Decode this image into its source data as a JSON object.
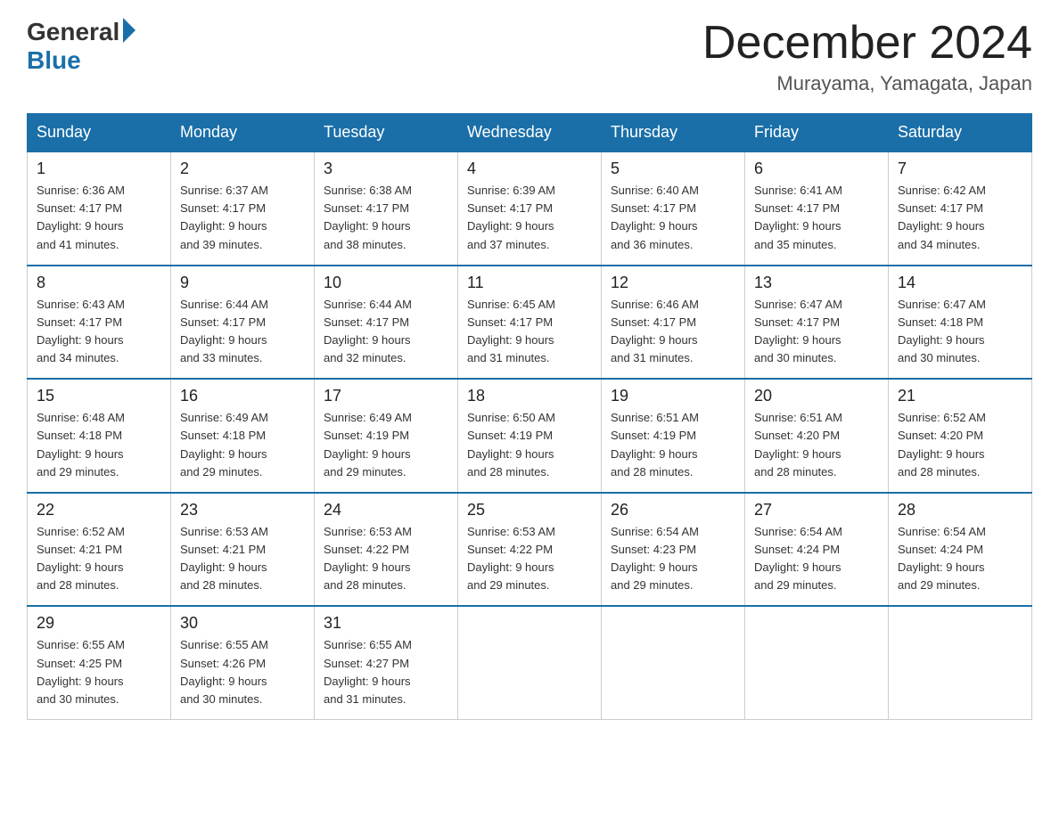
{
  "logo": {
    "text_general": "General",
    "text_blue": "Blue"
  },
  "header": {
    "title": "December 2024",
    "location": "Murayama, Yamagata, Japan"
  },
  "weekdays": [
    "Sunday",
    "Monday",
    "Tuesday",
    "Wednesday",
    "Thursday",
    "Friday",
    "Saturday"
  ],
  "weeks": [
    [
      {
        "day": "1",
        "sunrise": "6:36 AM",
        "sunset": "4:17 PM",
        "daylight": "9 hours and 41 minutes."
      },
      {
        "day": "2",
        "sunrise": "6:37 AM",
        "sunset": "4:17 PM",
        "daylight": "9 hours and 39 minutes."
      },
      {
        "day": "3",
        "sunrise": "6:38 AM",
        "sunset": "4:17 PM",
        "daylight": "9 hours and 38 minutes."
      },
      {
        "day": "4",
        "sunrise": "6:39 AM",
        "sunset": "4:17 PM",
        "daylight": "9 hours and 37 minutes."
      },
      {
        "day": "5",
        "sunrise": "6:40 AM",
        "sunset": "4:17 PM",
        "daylight": "9 hours and 36 minutes."
      },
      {
        "day": "6",
        "sunrise": "6:41 AM",
        "sunset": "4:17 PM",
        "daylight": "9 hours and 35 minutes."
      },
      {
        "day": "7",
        "sunrise": "6:42 AM",
        "sunset": "4:17 PM",
        "daylight": "9 hours and 34 minutes."
      }
    ],
    [
      {
        "day": "8",
        "sunrise": "6:43 AM",
        "sunset": "4:17 PM",
        "daylight": "9 hours and 34 minutes."
      },
      {
        "day": "9",
        "sunrise": "6:44 AM",
        "sunset": "4:17 PM",
        "daylight": "9 hours and 33 minutes."
      },
      {
        "day": "10",
        "sunrise": "6:44 AM",
        "sunset": "4:17 PM",
        "daylight": "9 hours and 32 minutes."
      },
      {
        "day": "11",
        "sunrise": "6:45 AM",
        "sunset": "4:17 PM",
        "daylight": "9 hours and 31 minutes."
      },
      {
        "day": "12",
        "sunrise": "6:46 AM",
        "sunset": "4:17 PM",
        "daylight": "9 hours and 31 minutes."
      },
      {
        "day": "13",
        "sunrise": "6:47 AM",
        "sunset": "4:17 PM",
        "daylight": "9 hours and 30 minutes."
      },
      {
        "day": "14",
        "sunrise": "6:47 AM",
        "sunset": "4:18 PM",
        "daylight": "9 hours and 30 minutes."
      }
    ],
    [
      {
        "day": "15",
        "sunrise": "6:48 AM",
        "sunset": "4:18 PM",
        "daylight": "9 hours and 29 minutes."
      },
      {
        "day": "16",
        "sunrise": "6:49 AM",
        "sunset": "4:18 PM",
        "daylight": "9 hours and 29 minutes."
      },
      {
        "day": "17",
        "sunrise": "6:49 AM",
        "sunset": "4:19 PM",
        "daylight": "9 hours and 29 minutes."
      },
      {
        "day": "18",
        "sunrise": "6:50 AM",
        "sunset": "4:19 PM",
        "daylight": "9 hours and 28 minutes."
      },
      {
        "day": "19",
        "sunrise": "6:51 AM",
        "sunset": "4:19 PM",
        "daylight": "9 hours and 28 minutes."
      },
      {
        "day": "20",
        "sunrise": "6:51 AM",
        "sunset": "4:20 PM",
        "daylight": "9 hours and 28 minutes."
      },
      {
        "day": "21",
        "sunrise": "6:52 AM",
        "sunset": "4:20 PM",
        "daylight": "9 hours and 28 minutes."
      }
    ],
    [
      {
        "day": "22",
        "sunrise": "6:52 AM",
        "sunset": "4:21 PM",
        "daylight": "9 hours and 28 minutes."
      },
      {
        "day": "23",
        "sunrise": "6:53 AM",
        "sunset": "4:21 PM",
        "daylight": "9 hours and 28 minutes."
      },
      {
        "day": "24",
        "sunrise": "6:53 AM",
        "sunset": "4:22 PM",
        "daylight": "9 hours and 28 minutes."
      },
      {
        "day": "25",
        "sunrise": "6:53 AM",
        "sunset": "4:22 PM",
        "daylight": "9 hours and 29 minutes."
      },
      {
        "day": "26",
        "sunrise": "6:54 AM",
        "sunset": "4:23 PM",
        "daylight": "9 hours and 29 minutes."
      },
      {
        "day": "27",
        "sunrise": "6:54 AM",
        "sunset": "4:24 PM",
        "daylight": "9 hours and 29 minutes."
      },
      {
        "day": "28",
        "sunrise": "6:54 AM",
        "sunset": "4:24 PM",
        "daylight": "9 hours and 29 minutes."
      }
    ],
    [
      {
        "day": "29",
        "sunrise": "6:55 AM",
        "sunset": "4:25 PM",
        "daylight": "9 hours and 30 minutes."
      },
      {
        "day": "30",
        "sunrise": "6:55 AM",
        "sunset": "4:26 PM",
        "daylight": "9 hours and 30 minutes."
      },
      {
        "day": "31",
        "sunrise": "6:55 AM",
        "sunset": "4:27 PM",
        "daylight": "9 hours and 31 minutes."
      },
      null,
      null,
      null,
      null
    ]
  ],
  "labels": {
    "sunrise": "Sunrise:",
    "sunset": "Sunset:",
    "daylight": "Daylight:"
  }
}
